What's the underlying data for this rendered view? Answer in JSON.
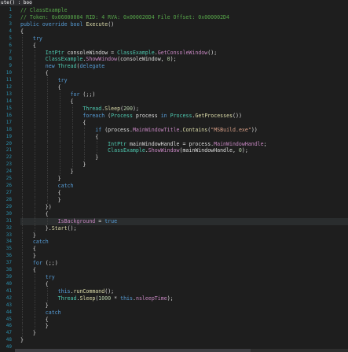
{
  "window": {
    "tab_title": "ute() : bool"
  },
  "editor": {
    "lines": [
      [
        {
          "t": "// ClassExample",
          "c": "c"
        }
      ],
      [
        {
          "t": "// Token: 0x06000004 RID: 4 RVA: 0x000020D4 File Offset: 0x000002D4",
          "c": "c"
        }
      ],
      [
        {
          "t": "public",
          "c": "k"
        },
        {
          "t": " ",
          "c": "p"
        },
        {
          "t": "override",
          "c": "k"
        },
        {
          "t": " ",
          "c": "p"
        },
        {
          "t": "bool",
          "c": "k"
        },
        {
          "t": " ",
          "c": "p"
        },
        {
          "t": "Execute",
          "c": "m"
        },
        {
          "t": "()",
          "c": "p"
        }
      ],
      [
        {
          "t": "{",
          "c": "p"
        }
      ],
      [
        {
          "t": "    try",
          "c": "k"
        }
      ],
      [
        {
          "t": "    {",
          "c": "p"
        }
      ],
      [
        {
          "t": "        ",
          "c": "p"
        },
        {
          "t": "IntPtr",
          "c": "t"
        },
        {
          "t": " consoleWindow = ",
          "c": "p"
        },
        {
          "t": "ClassExample",
          "c": "t"
        },
        {
          "t": ".",
          "c": "p"
        },
        {
          "t": "GetConsoleWindow",
          "c": "r"
        },
        {
          "t": "();",
          "c": "p"
        }
      ],
      [
        {
          "t": "        ",
          "c": "p"
        },
        {
          "t": "ClassExample",
          "c": "t"
        },
        {
          "t": ".",
          "c": "p"
        },
        {
          "t": "ShowWindow",
          "c": "r"
        },
        {
          "t": "(consoleWindow, ",
          "c": "p"
        },
        {
          "t": "0",
          "c": "n"
        },
        {
          "t": ");",
          "c": "p"
        }
      ],
      [
        {
          "t": "        ",
          "c": "p"
        },
        {
          "t": "new",
          "c": "k"
        },
        {
          "t": " ",
          "c": "p"
        },
        {
          "t": "Thread",
          "c": "t"
        },
        {
          "t": "(",
          "c": "p"
        },
        {
          "t": "delegate",
          "c": "k"
        }
      ],
      [
        {
          "t": "        {",
          "c": "p"
        }
      ],
      [
        {
          "t": "            try",
          "c": "k"
        }
      ],
      [
        {
          "t": "            {",
          "c": "p"
        }
      ],
      [
        {
          "t": "                ",
          "c": "p"
        },
        {
          "t": "for",
          "c": "k"
        },
        {
          "t": " (;;)",
          "c": "p"
        }
      ],
      [
        {
          "t": "                {",
          "c": "p"
        }
      ],
      [
        {
          "t": "                    ",
          "c": "p"
        },
        {
          "t": "Thread",
          "c": "t"
        },
        {
          "t": ".",
          "c": "p"
        },
        {
          "t": "Sleep",
          "c": "m"
        },
        {
          "t": "(",
          "c": "p"
        },
        {
          "t": "200",
          "c": "n"
        },
        {
          "t": ");",
          "c": "p"
        }
      ],
      [
        {
          "t": "                    ",
          "c": "p"
        },
        {
          "t": "foreach",
          "c": "k"
        },
        {
          "t": " (",
          "c": "p"
        },
        {
          "t": "Process",
          "c": "t"
        },
        {
          "t": " process ",
          "c": "p"
        },
        {
          "t": "in",
          "c": "k"
        },
        {
          "t": " ",
          "c": "p"
        },
        {
          "t": "Process",
          "c": "t"
        },
        {
          "t": ".",
          "c": "p"
        },
        {
          "t": "GetProcesses",
          "c": "m"
        },
        {
          "t": "())",
          "c": "p"
        }
      ],
      [
        {
          "t": "                    {",
          "c": "p"
        }
      ],
      [
        {
          "t": "                        ",
          "c": "p"
        },
        {
          "t": "if",
          "c": "k"
        },
        {
          "t": " (process.",
          "c": "p"
        },
        {
          "t": "MainWindowTitle",
          "c": "r"
        },
        {
          "t": ".",
          "c": "p"
        },
        {
          "t": "Contains",
          "c": "m"
        },
        {
          "t": "(",
          "c": "p"
        },
        {
          "t": "\"MSBuild.exe\"",
          "c": "s"
        },
        {
          "t": "))",
          "c": "p"
        }
      ],
      [
        {
          "t": "                        {",
          "c": "p"
        }
      ],
      [
        {
          "t": "                            ",
          "c": "p"
        },
        {
          "t": "IntPtr",
          "c": "t"
        },
        {
          "t": " mainWindowHandle = process.",
          "c": "p"
        },
        {
          "t": "MainWindowHandle",
          "c": "r"
        },
        {
          "t": ";",
          "c": "p"
        }
      ],
      [
        {
          "t": "                            ",
          "c": "p"
        },
        {
          "t": "ClassExample",
          "c": "t"
        },
        {
          "t": ".",
          "c": "p"
        },
        {
          "t": "ShowWindow",
          "c": "r"
        },
        {
          "t": "(mainWindowHandle, ",
          "c": "p"
        },
        {
          "t": "0",
          "c": "n"
        },
        {
          "t": ");",
          "c": "p"
        }
      ],
      [
        {
          "t": "                        }",
          "c": "p"
        }
      ],
      [
        {
          "t": "                    }",
          "c": "p"
        }
      ],
      [
        {
          "t": "                }",
          "c": "p"
        }
      ],
      [
        {
          "t": "            }",
          "c": "p"
        }
      ],
      [
        {
          "t": "            catch",
          "c": "k"
        }
      ],
      [
        {
          "t": "            {",
          "c": "p"
        }
      ],
      [
        {
          "t": "            }",
          "c": "p"
        }
      ],
      [
        {
          "t": "        })",
          "c": "p"
        }
      ],
      [
        {
          "t": "        {",
          "c": "p"
        }
      ],
      [
        {
          "t": "            ",
          "c": "p"
        },
        {
          "t": "IsBackground",
          "c": "r"
        },
        {
          "t": " = ",
          "c": "p"
        },
        {
          "t": "true",
          "c": "k"
        }
      ],
      [
        {
          "t": "        }.",
          "c": "p"
        },
        {
          "t": "Start",
          "c": "m"
        },
        {
          "t": "();",
          "c": "p"
        }
      ],
      [
        {
          "t": "    }",
          "c": "p"
        }
      ],
      [
        {
          "t": "    catch",
          "c": "k"
        }
      ],
      [
        {
          "t": "    {",
          "c": "p"
        }
      ],
      [
        {
          "t": "    }",
          "c": "p"
        }
      ],
      [
        {
          "t": "    ",
          "c": "p"
        },
        {
          "t": "for",
          "c": "k"
        },
        {
          "t": " (;;)",
          "c": "p"
        }
      ],
      [
        {
          "t": "    {",
          "c": "p"
        }
      ],
      [
        {
          "t": "        try",
          "c": "k"
        }
      ],
      [
        {
          "t": "        {",
          "c": "p"
        }
      ],
      [
        {
          "t": "            ",
          "c": "p"
        },
        {
          "t": "this",
          "c": "k"
        },
        {
          "t": ".",
          "c": "p"
        },
        {
          "t": "runCommand",
          "c": "m"
        },
        {
          "t": "();",
          "c": "p"
        }
      ],
      [
        {
          "t": "            ",
          "c": "p"
        },
        {
          "t": "Thread",
          "c": "t"
        },
        {
          "t": ".",
          "c": "p"
        },
        {
          "t": "Sleep",
          "c": "m"
        },
        {
          "t": "(",
          "c": "p"
        },
        {
          "t": "1000",
          "c": "n"
        },
        {
          "t": " * ",
          "c": "p"
        },
        {
          "t": "this",
          "c": "k"
        },
        {
          "t": ".",
          "c": "p"
        },
        {
          "t": "nsleepTime",
          "c": "r"
        },
        {
          "t": ");",
          "c": "p"
        }
      ],
      [
        {
          "t": "        }",
          "c": "p"
        }
      ],
      [
        {
          "t": "        catch",
          "c": "k"
        }
      ],
      [
        {
          "t": "        {",
          "c": "p"
        }
      ],
      [
        {
          "t": "        }",
          "c": "p"
        }
      ],
      [
        {
          "t": "    }",
          "c": "p"
        }
      ],
      [
        {
          "t": "}",
          "c": "p"
        }
      ],
      [
        {
          "t": "",
          "c": "p"
        }
      ]
    ],
    "selected_line": 31
  },
  "colors": {
    "background": "#1e1e1e",
    "line_number": "#2b91af",
    "comment": "#57a64a",
    "keyword": "#569cd6",
    "type": "#4ec9b0",
    "method": "#dcdcaa",
    "string": "#d69d85",
    "number": "#b5cea8",
    "member": "#c586c0"
  }
}
